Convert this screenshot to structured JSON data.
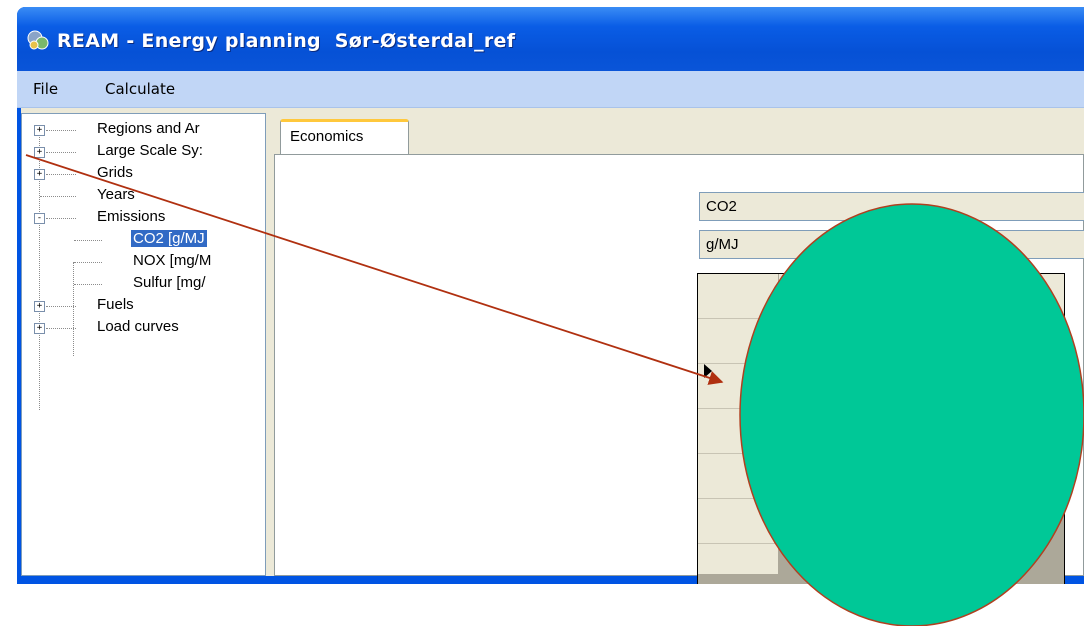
{
  "window": {
    "title": "REAM - Energy planning  Sør-Østerdal_ref"
  },
  "menu": {
    "items": [
      "File",
      "Calculate"
    ]
  },
  "tree": {
    "items": [
      {
        "label": "Regions and Ar",
        "expander": "+"
      },
      {
        "label": "Large Scale Sy:",
        "expander": "+"
      },
      {
        "label": "Grids",
        "expander": "+"
      },
      {
        "label": "Years",
        "expander": ""
      },
      {
        "label": "Emissions",
        "expander": "-"
      },
      {
        "label": "CO2  [g/MJ",
        "expander": "",
        "selected": true
      },
      {
        "label": "NOX  [mg/M",
        "expander": ""
      },
      {
        "label": "Sulfur  [mg/",
        "expander": ""
      },
      {
        "label": "Fuels",
        "expander": "+"
      },
      {
        "label": "Load curves",
        "expander": "+"
      }
    ]
  },
  "tabs": {
    "active": "Economics"
  },
  "fields": {
    "emission_name": "CO2",
    "emission_unit": "g/MJ"
  },
  "colors": {
    "titlebar": "#0a5de6",
    "menubar": "#c1d6f6",
    "selection": "#316ac5",
    "tab_highlight": "#ffc83c",
    "ellipse_fill": "#00c897",
    "ellipse_stroke": "#b04020",
    "arrow": "#b03010"
  }
}
